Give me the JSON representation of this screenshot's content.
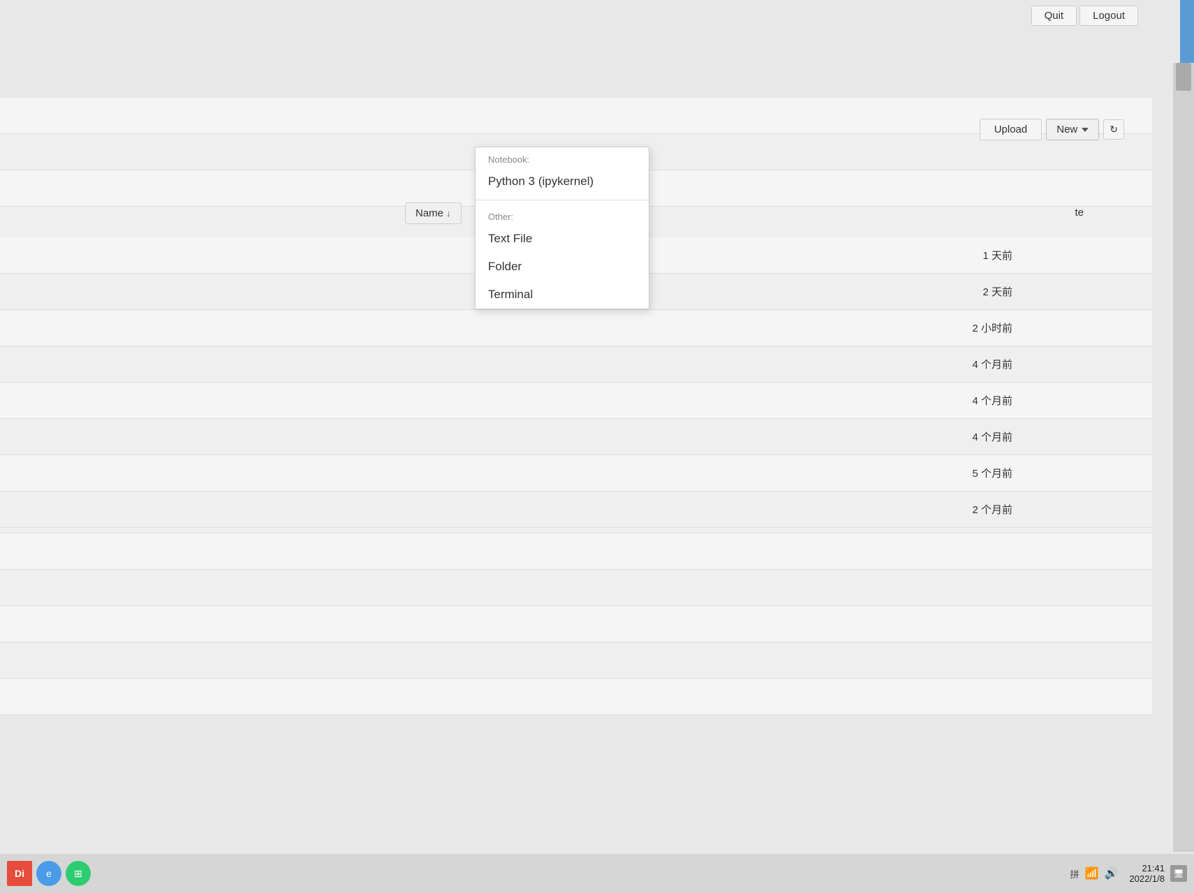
{
  "topbar": {
    "quit_label": "Quit",
    "logout_label": "Logout"
  },
  "toolbar": {
    "upload_label": "Upload",
    "new_label": "New",
    "refresh_icon": "↻"
  },
  "name_column": {
    "label": "Name",
    "sort_arrow": "↓"
  },
  "date_column": {
    "label": "te"
  },
  "dropdown": {
    "notebook_section": "Notebook:",
    "python_item": "Python 3 (ipykernel)",
    "other_section": "Other:",
    "text_file_item": "Text File",
    "folder_item": "Folder",
    "terminal_item": "Terminal"
  },
  "rows": [
    {
      "date": "1 天前"
    },
    {
      "date": "2 天前"
    },
    {
      "date": "2 小时前"
    },
    {
      "date": "4 个月前"
    },
    {
      "date": "4 个月前"
    },
    {
      "date": "4 个月前"
    },
    {
      "date": "5 个月前"
    },
    {
      "date": "2 个月前"
    }
  ],
  "taskbar": {
    "time": "21:41",
    "date": "2022/1/8",
    "kbd_label": "拼",
    "start_label": "Di"
  },
  "scrollbar": {
    "arrow_up": "▲"
  }
}
